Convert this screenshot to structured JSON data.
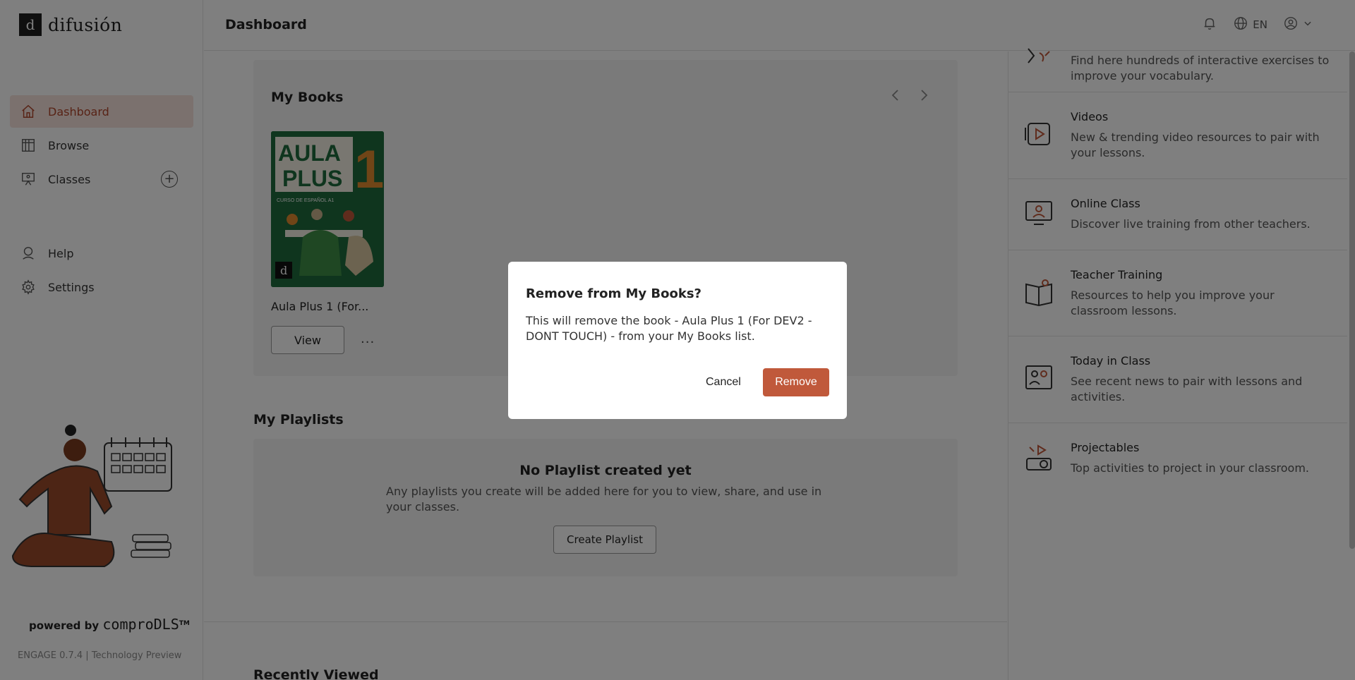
{
  "brand": {
    "logo_letter": "d",
    "logo_text": "difusión"
  },
  "sidebar": {
    "items": [
      {
        "label": "Dashboard",
        "icon": "home-icon"
      },
      {
        "label": "Browse",
        "icon": "library-icon"
      },
      {
        "label": "Classes",
        "icon": "classroom-icon"
      }
    ],
    "items2": [
      {
        "label": "Help",
        "icon": "help-icon"
      },
      {
        "label": "Settings",
        "icon": "gear-icon"
      }
    ],
    "powered_prefix": "powered by",
    "powered_brand": "comproDLS",
    "powered_tm": "TM",
    "version": "ENGAGE 0.7.4 | Technology Preview"
  },
  "header": {
    "title": "Dashboard",
    "language": "EN"
  },
  "main": {
    "my_books_title": "My Books",
    "book": {
      "title": "Aula Plus 1 (For...",
      "view_label": "View",
      "more_label": "...",
      "cover_line1": "AULA",
      "cover_line2": "PLUS",
      "cover_number": "1",
      "cover_sub": "CURSO DE ESPAÑOL A1"
    },
    "my_playlists_title": "My Playlists",
    "playlist_empty_title": "No Playlist created yet",
    "playlist_empty_text": "Any playlists you create will be added here for you to view, share, and use in your classes.",
    "create_playlist_label": "Create Playlist",
    "recently_viewed_title": "Recently Viewed"
  },
  "resources": [
    {
      "title": "",
      "desc": "Find here hundreds of interactive exercises to improve your vocabulary.",
      "icon": "exercises-icon"
    },
    {
      "title": "Videos",
      "desc": "New & trending video resources to pair with your lessons.",
      "icon": "video-icon"
    },
    {
      "title": "Online Class",
      "desc": "Discover live training from other teachers.",
      "icon": "online-class-icon"
    },
    {
      "title": "Teacher Training",
      "desc": "Resources to help you improve your classroom lessons.",
      "icon": "teacher-training-icon"
    },
    {
      "title": "Today in Class",
      "desc": "See recent news to pair with lessons and activities.",
      "icon": "today-in-class-icon"
    },
    {
      "title": "Projectables",
      "desc": "Top activities to project in your classroom.",
      "icon": "projector-icon"
    }
  ],
  "dialog": {
    "title": "Remove from My Books?",
    "text": "This will remove the book - Aula Plus 1 (For DEV2 - DONT TOUCH) - from your My Books list.",
    "cancel_label": "Cancel",
    "remove_label": "Remove"
  },
  "colors": {
    "accent": "#c0593b",
    "active_bg": "#f7e3dc",
    "book_green": "#1f6b3c"
  }
}
